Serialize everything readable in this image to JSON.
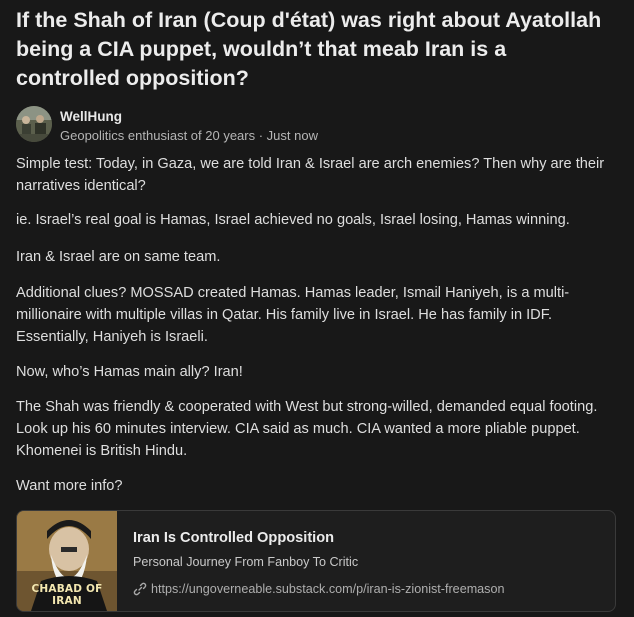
{
  "question": {
    "title": "If the Shah of Iran (Coup d'état) was right about Ayatollah being a CIA puppet, wouldn’t that meab Iran is a controlled opposition?"
  },
  "author": {
    "name": "WellHung",
    "credential": "Geopolitics enthusiast of 20 years",
    "separator": " · ",
    "time": "Just now"
  },
  "answer": {
    "paragraphs": [
      "Simple test: Today, in Gaza, we are told Iran & Israel are arch enemies? Then why are their narratives identical?",
      "ie. Israel’s real goal is Hamas, Israel achieved no goals, Israel losing, Hamas winning.",
      "Iran & Israel are on same team.",
      "Additional clues? MOSSAD created Hamas. Hamas leader, Ismail Haniyeh, is a multi-millionaire with multiple villas in Qatar. His family live in Israel. He has family in IDF. Essentially, Haniyeh is Israeli.",
      "Now, who’s Hamas main ally? Iran!",
      "The Shah was friendly & cooperated with West but strong-willed, demanded equal footing. Look up his 60 minutes interview. CIA said as much. CIA wanted a more pliable puppet. Khomenei is British Hindu.",
      "Want more info?"
    ]
  },
  "link_card": {
    "image_caption": "CHABAD OF IRAN",
    "title": "Iran Is Controlled Opposition",
    "subtitle": "Personal Journey From Fanboy To Critic",
    "url": "https://ungoverneable.substack.com/p/iran-is-zionist-freemason",
    "link_icon": "link-icon"
  }
}
